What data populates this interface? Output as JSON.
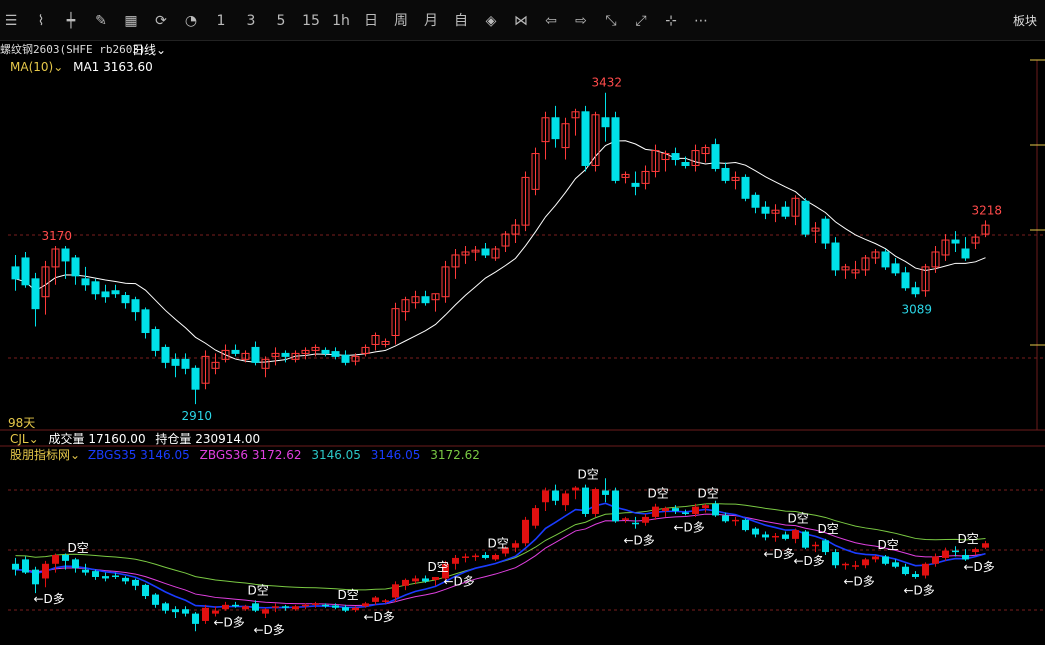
{
  "toolbar": {
    "icons": [
      "list-icon",
      "line-chart-icon",
      "candle-icon",
      "draw-icon",
      "keyboard-icon",
      "sync-icon",
      "bell-icon"
    ],
    "periods": [
      "1",
      "3",
      "5",
      "15",
      "1h",
      "日",
      "周",
      "月",
      "自"
    ],
    "nav_icons": [
      "diamond-left-icon",
      "shrink-icon",
      "arrow-left-icon",
      "arrow-right-icon",
      "zoom-in-icon",
      "zoom-out-icon",
      "cursor-icon",
      "more-icon"
    ],
    "right_label": "板块"
  },
  "header": {
    "contract": "螺纹钢2603(SHFE rb2603)",
    "period": "日线",
    "ma_label": "MA(10)",
    "ma1_text": "MA1 3163.60",
    "bars_label": "98天"
  },
  "volume": {
    "label": "CJL",
    "vol_text": "成交量 17160.00",
    "oi_text": "持仓量 230914.00"
  },
  "indicator": {
    "name": "股朋指标网",
    "zbgs35": "ZBGS35 3146.05",
    "zbgs36": "ZBGS36 3172.62",
    "v3": "3146.05",
    "v4": "3146.05",
    "v5": "3172.62",
    "signal_short": "D空",
    "signal_long": "←D多"
  },
  "colors": {
    "up": "#ff3b3b",
    "down": "#00e0e8",
    "ma": "#ffffff",
    "zb35": "#1a3cff",
    "zb36": "#e040e0",
    "mid": "#2bc7c7",
    "green": "#7ac943"
  },
  "chart_data": {
    "type": "candlestick",
    "annotations": [
      {
        "label": "3432",
        "kind": "high"
      },
      {
        "label": "3170",
        "kind": "high"
      },
      {
        "label": "3218",
        "kind": "high"
      },
      {
        "label": "2910",
        "kind": "low"
      },
      {
        "label": "3089",
        "kind": "low"
      }
    ],
    "bars": [
      [
        3140,
        3160,
        3100,
        3120
      ],
      [
        3155,
        3165,
        3105,
        3110
      ],
      [
        3120,
        3130,
        3040,
        3070
      ],
      [
        3090,
        3150,
        3060,
        3140
      ],
      [
        3140,
        3175,
        3110,
        3170
      ],
      [
        3170,
        3175,
        3120,
        3150
      ],
      [
        3155,
        3160,
        3110,
        3125
      ],
      [
        3120,
        3140,
        3100,
        3110
      ],
      [
        3115,
        3120,
        3085,
        3095
      ],
      [
        3098,
        3110,
        3080,
        3090
      ],
      [
        3100,
        3110,
        3088,
        3095
      ],
      [
        3092,
        3098,
        3070,
        3080
      ],
      [
        3085,
        3090,
        3050,
        3065
      ],
      [
        3068,
        3072,
        3020,
        3030
      ],
      [
        3035,
        3040,
        2990,
        3000
      ],
      [
        3005,
        3010,
        2970,
        2980
      ],
      [
        2985,
        2995,
        2955,
        2975
      ],
      [
        2985,
        2995,
        2960,
        2970
      ],
      [
        2970,
        2975,
        2910,
        2935
      ],
      [
        2945,
        3000,
        2935,
        2990
      ],
      [
        2970,
        2995,
        2960,
        2980
      ],
      [
        2985,
        3010,
        2980,
        3000
      ],
      [
        3000,
        3010,
        2990,
        2995
      ],
      [
        2985,
        3000,
        2980,
        2995
      ],
      [
        3005,
        3015,
        2975,
        2980
      ],
      [
        2970,
        2990,
        2955,
        2985
      ],
      [
        2990,
        3005,
        2975,
        2995
      ],
      [
        2995,
        3000,
        2980,
        2990
      ],
      [
        2985,
        3000,
        2980,
        2995
      ],
      [
        2995,
        3005,
        2985,
        3000
      ],
      [
        3000,
        3010,
        2990,
        3005
      ],
      [
        3000,
        3005,
        2990,
        2995
      ],
      [
        2998,
        3005,
        2985,
        2990
      ],
      [
        2992,
        3000,
        2975,
        2980
      ],
      [
        2982,
        2995,
        2975,
        2990
      ],
      [
        2995,
        3010,
        2990,
        3005
      ],
      [
        3010,
        3030,
        3000,
        3025
      ],
      [
        3010,
        3020,
        3005,
        3015
      ],
      [
        3025,
        3080,
        3010,
        3070
      ],
      [
        3065,
        3090,
        3050,
        3085
      ],
      [
        3080,
        3100,
        3070,
        3090
      ],
      [
        3090,
        3100,
        3075,
        3080
      ],
      [
        3085,
        3095,
        3065,
        3095
      ],
      [
        3090,
        3150,
        3080,
        3140
      ],
      [
        3140,
        3170,
        3120,
        3160
      ],
      [
        3160,
        3175,
        3145,
        3165
      ],
      [
        3165,
        3175,
        3150,
        3168
      ],
      [
        3170,
        3180,
        3155,
        3160
      ],
      [
        3155,
        3175,
        3150,
        3170
      ],
      [
        3175,
        3200,
        3165,
        3195
      ],
      [
        3195,
        3220,
        3180,
        3210
      ],
      [
        3210,
        3300,
        3200,
        3290
      ],
      [
        3270,
        3340,
        3260,
        3330
      ],
      [
        3350,
        3400,
        3320,
        3390
      ],
      [
        3390,
        3410,
        3340,
        3355
      ],
      [
        3340,
        3390,
        3320,
        3380
      ],
      [
        3390,
        3405,
        3360,
        3400
      ],
      [
        3400,
        3410,
        3300,
        3310
      ],
      [
        3310,
        3400,
        3300,
        3395
      ],
      [
        3390,
        3432,
        3350,
        3375
      ],
      [
        3390,
        3400,
        3280,
        3285
      ],
      [
        3290,
        3300,
        3280,
        3295
      ],
      [
        3280,
        3300,
        3260,
        3275
      ],
      [
        3280,
        3310,
        3270,
        3300
      ],
      [
        3300,
        3345,
        3290,
        3335
      ],
      [
        3320,
        3335,
        3300,
        3330
      ],
      [
        3330,
        3340,
        3310,
        3320
      ],
      [
        3315,
        3325,
        3305,
        3310
      ],
      [
        3310,
        3345,
        3300,
        3335
      ],
      [
        3330,
        3345,
        3315,
        3340
      ],
      [
        3345,
        3355,
        3300,
        3305
      ],
      [
        3305,
        3315,
        3280,
        3285
      ],
      [
        3285,
        3300,
        3270,
        3290
      ],
      [
        3290,
        3295,
        3250,
        3255
      ],
      [
        3260,
        3265,
        3230,
        3240
      ],
      [
        3240,
        3250,
        3220,
        3230
      ],
      [
        3230,
        3245,
        3215,
        3235
      ],
      [
        3240,
        3250,
        3220,
        3225
      ],
      [
        3225,
        3260,
        3210,
        3255
      ],
      [
        3250,
        3255,
        3190,
        3195
      ],
      [
        3200,
        3215,
        3180,
        3205
      ],
      [
        3220,
        3225,
        3170,
        3180
      ],
      [
        3180,
        3190,
        3125,
        3135
      ],
      [
        3135,
        3145,
        3120,
        3140
      ],
      [
        3130,
        3150,
        3120,
        3135
      ],
      [
        3135,
        3160,
        3125,
        3155
      ],
      [
        3155,
        3170,
        3145,
        3165
      ],
      [
        3165,
        3170,
        3135,
        3140
      ],
      [
        3145,
        3155,
        3125,
        3130
      ],
      [
        3130,
        3140,
        3100,
        3105
      ],
      [
        3105,
        3115,
        3089,
        3095
      ],
      [
        3100,
        3145,
        3090,
        3140
      ],
      [
        3140,
        3175,
        3130,
        3165
      ],
      [
        3160,
        3195,
        3150,
        3185
      ],
      [
        3185,
        3200,
        3165,
        3180
      ],
      [
        3170,
        3190,
        3150,
        3155
      ],
      [
        3180,
        3195,
        3170,
        3190
      ],
      [
        3195,
        3218,
        3190,
        3210
      ]
    ]
  }
}
